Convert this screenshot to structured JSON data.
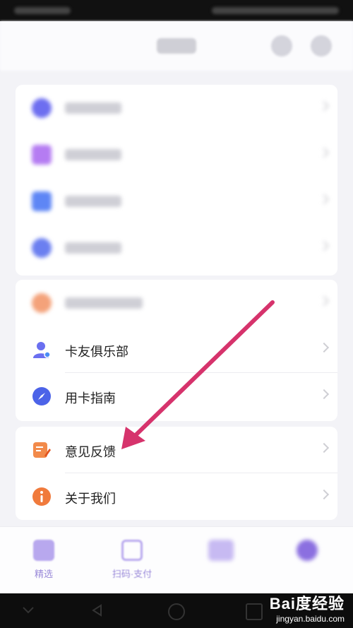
{
  "menu": {
    "items": [
      {
        "label": "卡友俱乐部",
        "icon": "person-badge-icon"
      },
      {
        "label": "用卡指南",
        "icon": "compass-icon"
      },
      {
        "label": "意见反馈",
        "icon": "feedback-edit-icon"
      },
      {
        "label": "关于我们",
        "icon": "info-icon"
      }
    ]
  },
  "tabbar": {
    "tabs": [
      {
        "label": "精选",
        "icon": "featured-icon"
      },
      {
        "label": "扫码·支付",
        "icon": "scan-icon"
      },
      {
        "label": "",
        "icon": "card-icon"
      },
      {
        "label": "",
        "icon": "profile-icon"
      }
    ]
  },
  "watermark": {
    "brand": "Bai度经验",
    "url": "jingyan.baidu.com"
  },
  "colors": {
    "accent": "#8b6fe0",
    "arrow": "#d6336c"
  }
}
